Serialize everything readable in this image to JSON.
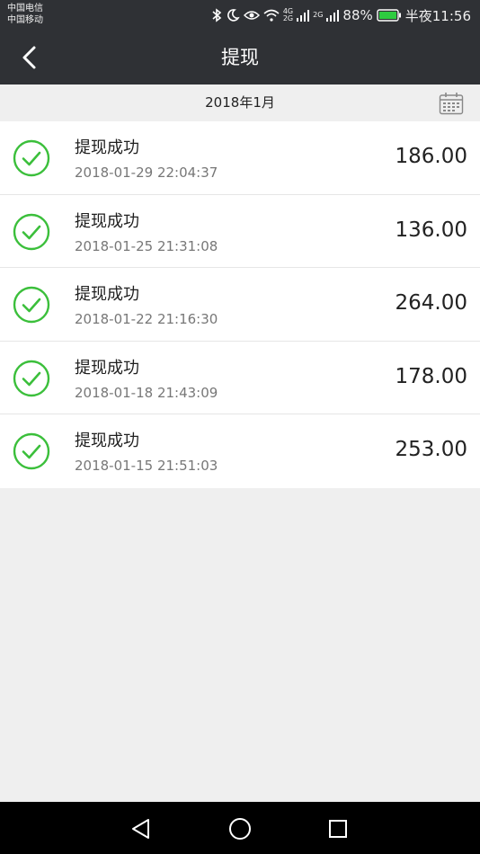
{
  "status": {
    "carrier1": "中国电信",
    "carrier2": "中国移动",
    "net1_top": "4G",
    "net1_bottom": "2G",
    "net2": "2G",
    "battery": "88%",
    "time": "半夜11:56",
    "icons": [
      "bluetooth-icon",
      "moon-icon",
      "eye-icon",
      "wifi-icon",
      "signal-icon",
      "battery-icon"
    ]
  },
  "topbar": {
    "title": "提现"
  },
  "filter": {
    "month": "2018年1月"
  },
  "records": [
    {
      "title": "提现成功",
      "time": "2018-01-29 22:04:37",
      "amount": "186.00"
    },
    {
      "title": "提现成功",
      "time": "2018-01-25 21:31:08",
      "amount": "136.00"
    },
    {
      "title": "提现成功",
      "time": "2018-01-22 21:16:30",
      "amount": "264.00"
    },
    {
      "title": "提现成功",
      "time": "2018-01-18 21:43:09",
      "amount": "178.00"
    },
    {
      "title": "提现成功",
      "time": "2018-01-15 21:51:03",
      "amount": "253.00"
    }
  ],
  "colors": {
    "header": "#2f3135",
    "success": "#3bbf3b",
    "battery": "#2ecc40",
    "background": "#efefef"
  }
}
